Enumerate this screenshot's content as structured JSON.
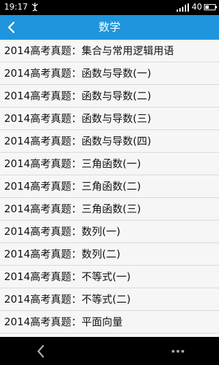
{
  "status_bar": {
    "time": "19:17",
    "battery": "40",
    "battery_level": 0.4
  },
  "header": {
    "title": "数学"
  },
  "list": {
    "items": [
      "2014高考真题：集合与常用逻辑用语",
      "2014高考真题：函数与导数(一)",
      "2014高考真题：函数与导数(二)",
      "2014高考真题：函数与导数(三)",
      "2014高考真题：函数与导数(四)",
      "2014高考真题：三角函数(一)",
      "2014高考真题：三角函数(二)",
      "2014高考真题：三角函数(三)",
      "2014高考真题：数列(一)",
      "2014高考真题：数列(二)",
      "2014高考真题：不等式(一)",
      "2014高考真题：不等式(二)",
      "2014高考真题：平面向量"
    ]
  },
  "icons": {
    "usb": "usb-icon",
    "signal": "signal-icon",
    "battery": "battery-icon",
    "back": "chevron-left-icon",
    "nav_back": "nav-back-icon",
    "menu": "more-icon"
  },
  "colors": {
    "header_bg": "#1e95dc",
    "status_bg": "#000000",
    "list_bg": "#f6f6f6"
  }
}
